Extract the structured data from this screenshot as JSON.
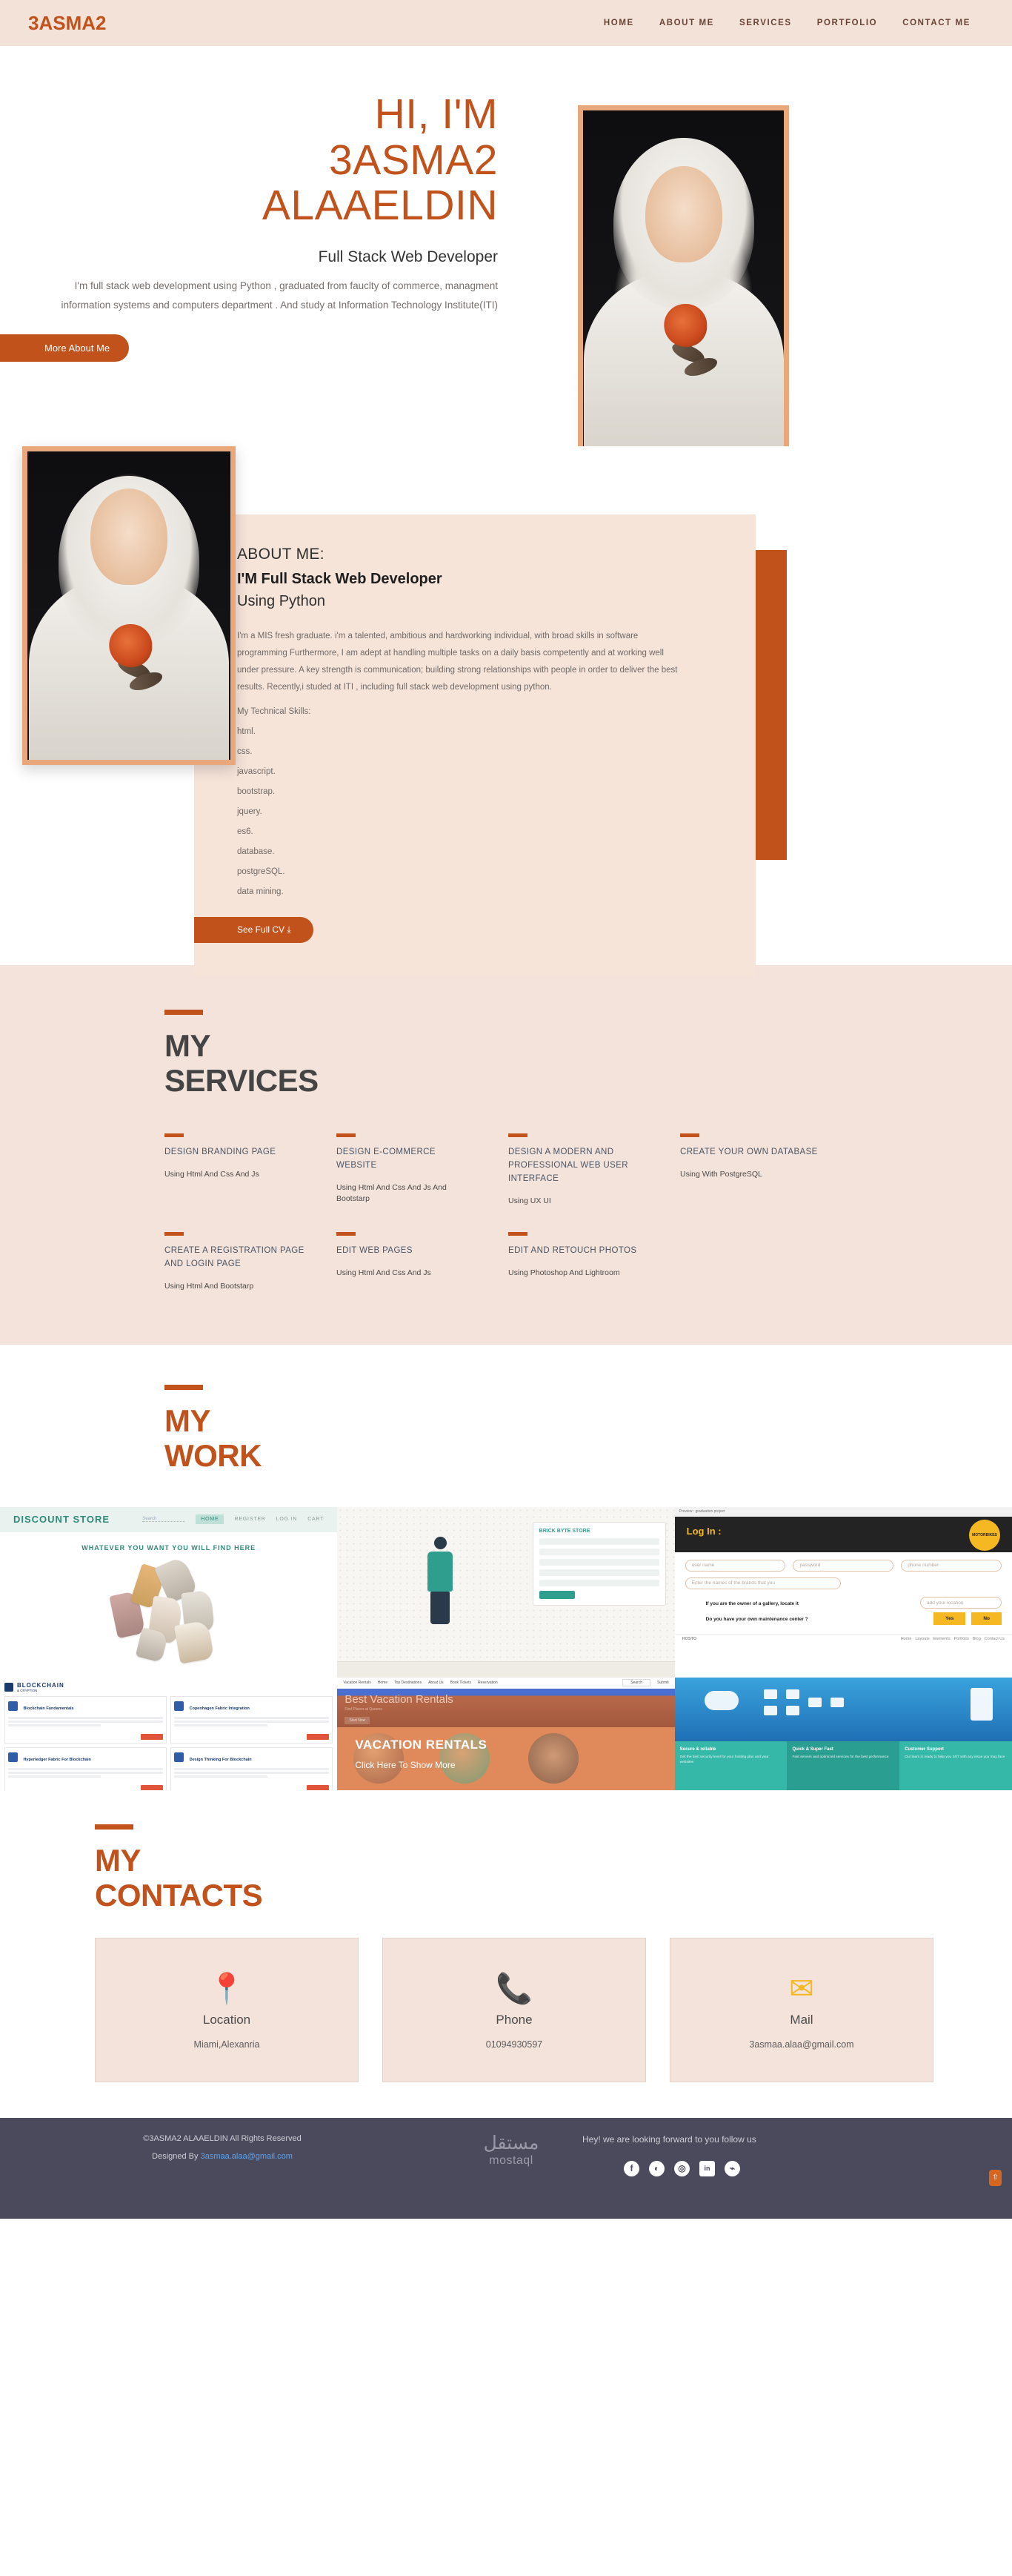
{
  "nav": {
    "brand": "3ASMA2",
    "links": [
      {
        "label": "HOME"
      },
      {
        "label": "ABOUT ME"
      },
      {
        "label": "SERVICES"
      },
      {
        "label": "PORTFOLIO"
      },
      {
        "label": "CONTACT ME"
      }
    ]
  },
  "hero": {
    "line1": "HI, I'M",
    "line2": "3ASMA2",
    "line3": "ALAAELDIN",
    "subtitle": "Full Stack Web Developer",
    "description": "I'm full stack web development using Python , graduated from fauclty of commerce, managment information systems and computers department . And study at Information Technology Institute(ITI)",
    "cta": "More About Me"
  },
  "about": {
    "kicker": "ABOUT ME:",
    "heading": "I'M Full Stack Web Developer",
    "subheading": "Using Python",
    "paragraph": "I'm a MIS fresh graduate. i'm a talented, ambitious and hardworking individual, with broad skills in software programming Furthermore, I am adept at handling multiple tasks on a daily basis competently and at working well under pressure. A key strength is communication; building strong relationships with people in order to deliver the best results. Recently,i studed at ITI , including full stack web development using python.",
    "skills_label": "My Technical Skills:",
    "skills": [
      "html.",
      "css.",
      "javascript.",
      "bootstrap.",
      "jquery.",
      "es6.",
      "database.",
      "postgreSQL.",
      "data mining."
    ],
    "cv_button": "See Full CV ⤓"
  },
  "services": {
    "title_line1": "MY",
    "title_line2": "SERVICES",
    "items": [
      {
        "title": "DESIGN BRANDING PAGE",
        "sub": "Using Html And Css And Js"
      },
      {
        "title": "DESIGN E-COMMERCE WEBSITE",
        "sub": "Using Html And Css And Js And Bootstarp"
      },
      {
        "title": "DESIGN A MODERN AND PROFESSIONAL WEB USER INTERFACE",
        "sub": "Using UX UI"
      },
      {
        "title": "CREATE YOUR OWN DATABASE",
        "sub": "Using With PostgreSQL"
      },
      {
        "title": "CREATE A REGISTRATION PAGE AND LOGIN PAGE",
        "sub": "Using Html And Bootstarp"
      },
      {
        "title": "EDIT WEB PAGES",
        "sub": "Using Html And Css And Js"
      },
      {
        "title": "EDIT AND RETOUCH PHOTOS",
        "sub": "Using Photoshop And Lightroom"
      }
    ]
  },
  "work": {
    "title_line1": "MY",
    "title_line2": "WORK",
    "shots": {
      "discount_store": {
        "logo": "DISCOUNT STORE",
        "search_placeholder": "Search",
        "nav": [
          "HOME",
          "REGISTER",
          "LOG IN",
          "CART"
        ],
        "headline": "WHATEVER YOU WANT YOU WILL FIND HERE"
      },
      "wireframe": {
        "card_title": "BRICK BYTE STORE"
      },
      "login": {
        "window_title": "Preview : graduation project",
        "heading": "Log In :",
        "badge": "MOTORBIKES",
        "fields": [
          "user name",
          "password",
          "phone number",
          "Enter the names of the brands that you"
        ],
        "question1": "If you are the owner of a gallery, locate it",
        "location_placeholder": "add your location",
        "question2": "Do you have your own maintenance center ?",
        "yes": "Yes",
        "no": "No",
        "footer_logo": "HOSTO",
        "footer_links": [
          "Home",
          "Layouts",
          "Elements",
          "Portfolio",
          "Blog",
          "Contact Us"
        ]
      },
      "blockchain": {
        "title": "BLOCKCHAIN",
        "subtitle": "& CRYPTION",
        "cards": [
          {
            "title": "Blockchain Fundamentals",
            "cta": "Read More"
          },
          {
            "title": "Copenhagen Fabric Integration",
            "cta": "Read More"
          },
          {
            "title": "Hyperledger Fabric For Blockchain",
            "cta": "Read More"
          },
          {
            "title": "Design Thinking For Blockchain",
            "cta": "Read More"
          }
        ]
      },
      "vacation": {
        "nav": [
          "Vacation Rentals",
          "Home",
          "Top Destinations",
          "About Us",
          "Book Tickets",
          "Reservation"
        ],
        "search_placeholder": "Search",
        "submit": "Submit",
        "hero_title": "Best Vacation Rentals",
        "hero_sub": "Find Places at Queens",
        "hero_btn": "Start Now",
        "band_title": "VACATION RENTALS",
        "band_sub": "Click Here To Show More"
      },
      "hosting": {
        "cards": [
          {
            "title": "Secure & reliable",
            "text": "Get the best security level for your hosting plan and your websites"
          },
          {
            "title": "Quick & Super Fast",
            "text": "Fast servers and optimized services for the best performance"
          },
          {
            "title": "Customer Support",
            "text": "Our team is ready to help you 24/7 with any issue you may face"
          }
        ]
      }
    }
  },
  "contacts": {
    "title_line1": "MY",
    "title_line2": "CONTACTS",
    "cards": [
      {
        "icon": "location-pin-icon",
        "glyph": "📍",
        "label": "Location",
        "value": "Miami,Alexanria"
      },
      {
        "icon": "phone-icon",
        "glyph": "📞",
        "label": "Phone",
        "value": "01094930597"
      },
      {
        "icon": "mail-icon",
        "glyph": "✉",
        "label": "Mail",
        "value": "3asmaa.alaa@gmail.com"
      }
    ]
  },
  "footer": {
    "copyright": "©3ASMA2 ALAAELDIN All Rights Reserved",
    "designed_by_prefix": "Designed By ",
    "designed_by_email": "3asmaa.alaa@gmail.com",
    "brand_arabic": "مستقل",
    "brand_latin": "mostaql",
    "follow_text": "Hey! we are looking forward to you follow us",
    "socials": [
      {
        "name": "facebook-icon",
        "glyph": "f"
      },
      {
        "name": "github-icon",
        "glyph": "◐"
      },
      {
        "name": "instagram-icon",
        "glyph": "◎"
      },
      {
        "name": "linkedin-icon",
        "glyph": "in"
      },
      {
        "name": "messenger-icon",
        "glyph": "⌁"
      }
    ],
    "to_top": "⇧"
  },
  "colors": {
    "accent": "#c1521b",
    "cream": "#f4e3da",
    "nav_bg": "#f2e2d8",
    "footer_bg": "#4a4a5c",
    "link_blue": "#5aa3f0"
  }
}
